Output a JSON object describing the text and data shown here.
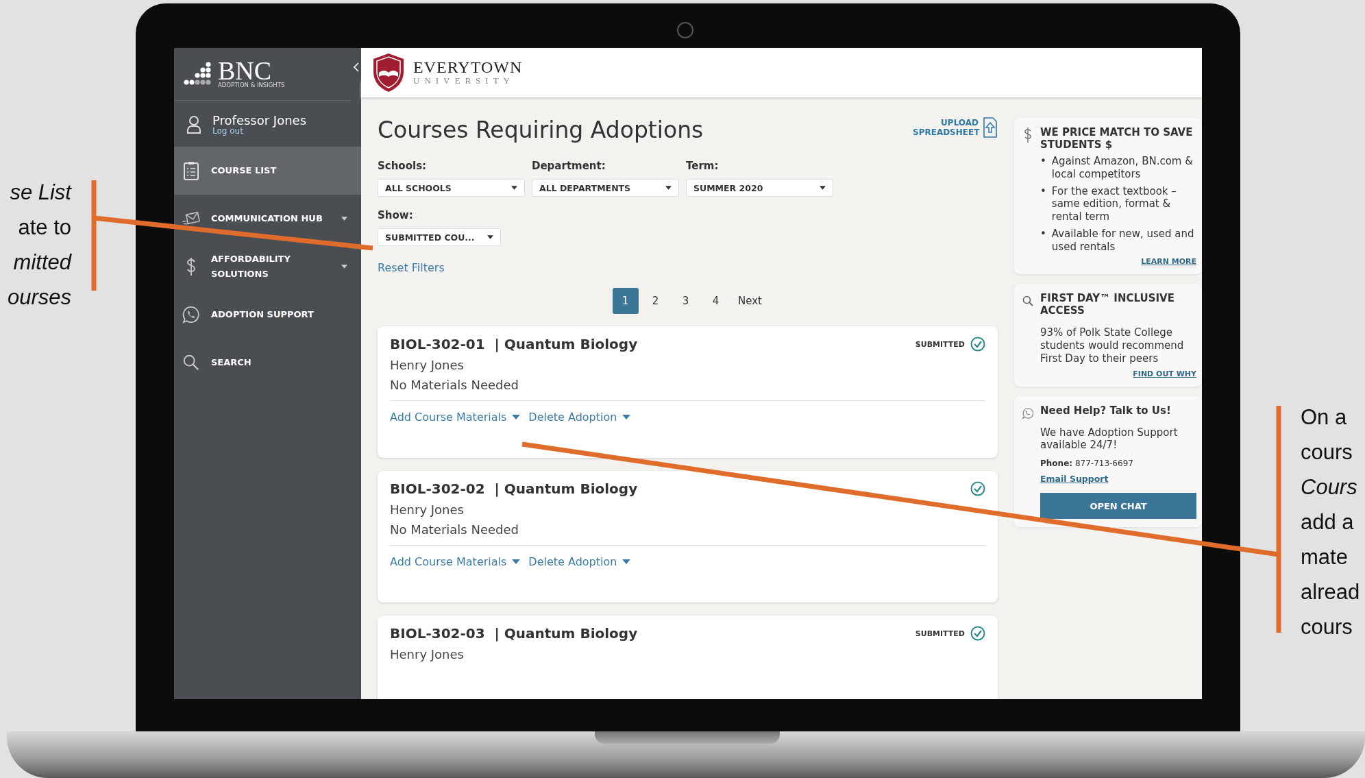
{
  "slide": {
    "left_note": [
      {
        "text": "se List",
        "italic": true
      },
      {
        "text": "ate to",
        "italic": false
      },
      {
        "text": "mitted",
        "italic": true
      },
      {
        "text": "ourses",
        "italic": true
      }
    ],
    "right_note": [
      {
        "text": "On a",
        "italic": false
      },
      {
        "text": "cours",
        "italic": false
      },
      {
        "text": "Cours",
        "italic": true
      },
      {
        "text": "add a",
        "italic": false
      },
      {
        "text": "mate",
        "italic": false
      },
      {
        "text": "alread",
        "italic": false
      },
      {
        "text": "cours",
        "italic": false
      }
    ]
  },
  "sidebar": {
    "brand": "BNC",
    "brand_sub": "ADOPTION & INSIGHTS",
    "user": {
      "name": "Professor Jones",
      "logout": "Log out"
    },
    "items": [
      {
        "label": "COURSE LIST",
        "selected": true,
        "expandable": false
      },
      {
        "label": "COMMUNICATION HUB",
        "selected": false,
        "expandable": true
      },
      {
        "label": "AFFORDABILITY SOLUTIONS",
        "selected": false,
        "expandable": true
      },
      {
        "label": "ADOPTION SUPPORT",
        "selected": false,
        "expandable": false
      },
      {
        "label": "SEARCH",
        "selected": false,
        "expandable": false
      }
    ]
  },
  "header": {
    "university_name": "EVERYTOWN",
    "university_sub": "UNIVERSITY"
  },
  "page": {
    "title": "Courses Requiring Adoptions",
    "upload": "UPLOAD SPREADSHEET",
    "filters": [
      {
        "label": "Schools:",
        "value": "ALL SCHOOLS"
      },
      {
        "label": "Department:",
        "value": "ALL DEPARTMENTS"
      },
      {
        "label": "Term:",
        "value": "SUMMER 2020"
      }
    ],
    "show": {
      "label": "Show:",
      "value": "SUBMITTED COU..."
    },
    "reset": "Reset Filters",
    "pages": [
      {
        "label": "1",
        "selected": true
      },
      {
        "label": "2",
        "selected": false
      },
      {
        "label": "3",
        "selected": false
      },
      {
        "label": "4",
        "selected": false
      }
    ],
    "next": "Next",
    "courses": [
      {
        "code": "BIOL-302-01",
        "name": "| Quantum Biology",
        "instructor": "Henry Jones",
        "materials": "No Materials Needed",
        "status_label": "SUBMITTED",
        "submitted": true,
        "actions": [
          "Add Course Materials",
          "Delete Adoption"
        ]
      },
      {
        "code": "BIOL-302-02",
        "name": "| Quantum Biology",
        "instructor": "Henry Jones",
        "materials": "No Materials Needed",
        "submitted": true,
        "actions": [
          "Add Course Materials",
          "Delete Adoption"
        ]
      },
      {
        "code": "BIOL-302-03",
        "name": "| Quantum Biology",
        "instructor": "Henry Jones",
        "status_label": "SUBMITTED",
        "submitted": true
      }
    ]
  },
  "right_panel": [
    {
      "kind": "list",
      "title": "WE PRICE MATCH TO SAVE STUDENTS $",
      "marker": "•",
      "bullets": [
        "Against Amazon, BN.com & local competitors",
        "For the exact textbook – same edition, format & rental term",
        "Available for new, used and used rentals"
      ],
      "link": "LEARN MORE"
    },
    {
      "kind": "text",
      "title": "FIRST DAY™ INCLUSIVE ACCESS",
      "body": "93% of Polk State College students would recommend First Day to their peers",
      "link": "FIND OUT WHY"
    },
    {
      "kind": "contact",
      "title": "Need Help? Talk to Us!",
      "body": "We have Adoption Support available 24/7!",
      "phone_label": "Phone:",
      "phone": "877-713-6697",
      "link": "Email Support",
      "button": "OPEN CHAT"
    }
  ]
}
